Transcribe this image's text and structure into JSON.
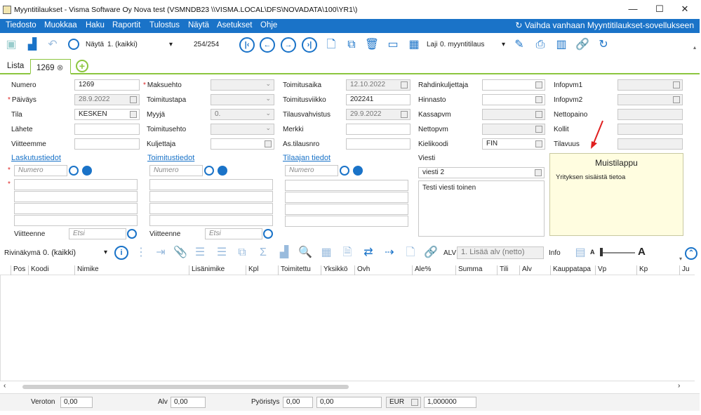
{
  "window": {
    "title": "Myyntitilaukset - Visma Software Oy Nova test (VSMNDB23 \\\\VISMA.LOCAL\\DFS\\NOVADATA\\100\\YR1\\)"
  },
  "menu": {
    "items": [
      "Tiedosto",
      "Muokkaa",
      "Haku",
      "Raportit",
      "Tulostus",
      "Näytä",
      "Asetukset",
      "Ohje"
    ],
    "switch_label": "Vaihda vanhaan Myyntitilaukset-sovellukseen"
  },
  "toolbar": {
    "view_label": "Näytä",
    "view_value": "1. (kaikki)",
    "record_counter": "254/254",
    "type_label": "Laji",
    "type_value": "0. myyntitilaus"
  },
  "tabs": {
    "list": "Lista",
    "current": "1269"
  },
  "form": {
    "col1": [
      {
        "label": "Numero",
        "value": "1269",
        "req": ""
      },
      {
        "label": "Päiväys",
        "value": "28.9.2022",
        "req": "*"
      },
      {
        "label": "Tila",
        "value": "KESKEN",
        "req": ""
      },
      {
        "label": "Lähete",
        "value": "",
        "req": ""
      },
      {
        "label": "Viitteemme",
        "value": "",
        "req": ""
      }
    ],
    "col2": [
      {
        "label": "Maksuehto",
        "value": "",
        "req": "*"
      },
      {
        "label": "Toimitustapa",
        "value": "",
        "req": ""
      },
      {
        "label": "Myyjä",
        "value": "0.",
        "req": ""
      },
      {
        "label": "Toimitusehto",
        "value": "",
        "req": ""
      },
      {
        "label": "Kuljettaja",
        "value": "",
        "req": ""
      }
    ],
    "col3": [
      {
        "label": "Toimitusaika",
        "value": "12.10.2022"
      },
      {
        "label": "Toimitusviikko",
        "value": "202241"
      },
      {
        "label": "Tilausvahvistus",
        "value": "29.9.2022"
      },
      {
        "label": "Merkki",
        "value": ""
      },
      {
        "label": "As.tilausnro",
        "value": ""
      }
    ],
    "col4": [
      {
        "label": "Rahdinkuljettaja",
        "value": ""
      },
      {
        "label": "Hinnasto",
        "value": ""
      },
      {
        "label": "Kassapvm",
        "value": ""
      },
      {
        "label": "Nettopvm",
        "value": ""
      },
      {
        "label": "Kielikoodi",
        "value": "FIN"
      }
    ],
    "col5": [
      {
        "label": "Infopvm1",
        "value": ""
      },
      {
        "label": "Infopvm2",
        "value": ""
      },
      {
        "label": "Nettopaino",
        "value": ""
      },
      {
        "label": "Kollit",
        "value": ""
      },
      {
        "label": "Tilavuus",
        "value": ""
      }
    ]
  },
  "sections": {
    "invoice": "Laskutustiedot",
    "delivery": "Toimitustiedot",
    "customer": "Tilaajan tiedot",
    "number_placeholder": "Numero",
    "reference_label": "Viitteenne",
    "search_placeholder": "Etsi"
  },
  "message": {
    "label": "Viesti",
    "value": "viesti 2",
    "text": "Testi viesti toinen"
  },
  "memo": {
    "title": "Muistilappu",
    "text": "Yrityksen sisäistä tietoa"
  },
  "grid": {
    "row_view_label": "Rivinäkymä",
    "row_view_value": "0. (kaikki)",
    "alv_label": "ALV",
    "alv_value": "1. Lisää alv (netto)",
    "info_label": "Info",
    "columns": [
      "Pos",
      "Koodi",
      "Nimike",
      "Lisänimike",
      "Kpl",
      "Toimitettu",
      "Yksikkö",
      "Ovh",
      "Ale%",
      "Summa",
      "Tili",
      "Alv",
      "Kauppatapa",
      "Vp",
      "Kp",
      "Ju"
    ]
  },
  "footer": {
    "veroton_label": "Veroton",
    "veroton_value": "0,00",
    "alv_label": "Alv",
    "alv_value": "0,00",
    "rounding_label": "Pyöristys",
    "rounding_value1": "0,00",
    "rounding_value2": "0,00",
    "currency": "EUR",
    "rate": "1,000000"
  },
  "colors": {
    "accent": "#1a73c8",
    "tab_border": "#8cc63f",
    "required": "#dd2222"
  }
}
